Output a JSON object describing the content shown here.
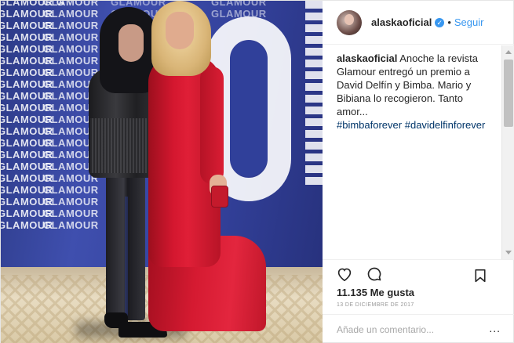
{
  "header": {
    "username": "alaskaoficial",
    "verified_icon": "verified-badge-icon",
    "separator": "•",
    "follow_label": "Seguir"
  },
  "photo": {
    "backdrop_word": "GLAMOUR",
    "backdrop_mirrored": "GLAMOUR G",
    "description_icon": "post-photo"
  },
  "caption": {
    "user": "alaskaoficial",
    "text": "Anoche la revista Glamour entregó un premio a David Delfín y Bimba. Mario y Bibiana lo recogieron. Tanto amor...",
    "hashtags": [
      "#bimbaforever",
      "#davidelfinforever"
    ]
  },
  "actions": {
    "like_icon": "heart-icon",
    "comment_icon": "comment-icon",
    "save_icon": "bookmark-icon"
  },
  "likes": "11.135 Me gusta",
  "date": "13 DE DICIEMBRE DE 2017",
  "comment": {
    "placeholder": "Añade un comentario...",
    "more_label": "..."
  },
  "colors": {
    "link_blue": "#3897f0",
    "hashtag_blue": "#003569",
    "text": "#262626",
    "muted": "#999999",
    "backdrop_blue": "#3444a0",
    "dress_red": "#d51a31"
  }
}
